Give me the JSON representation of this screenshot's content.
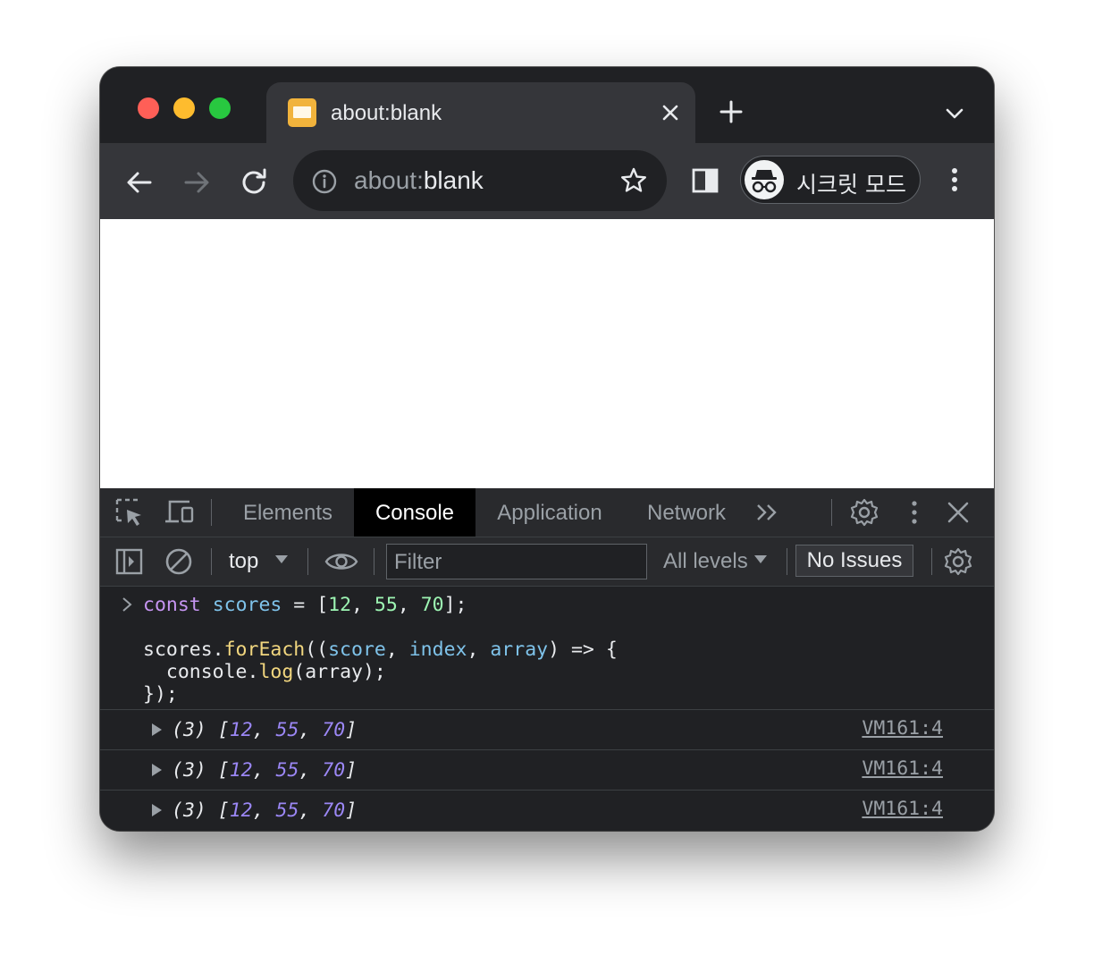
{
  "tab": {
    "title": "about:blank",
    "close_icon": "close-icon"
  },
  "omnibox": {
    "scheme": "about:",
    "host": "blank"
  },
  "incognito": {
    "label": "시크릿 모드"
  },
  "devtools": {
    "tabs": [
      "Elements",
      "Console",
      "Application",
      "Network"
    ],
    "active_tab": "Console",
    "context": "top",
    "filter_placeholder": "Filter",
    "levels": "All levels",
    "issues": "No Issues"
  },
  "console": {
    "input": {
      "line1": {
        "kw": "const",
        "name": "scores",
        "eq": " = [",
        "n1": "12",
        "n2": "55",
        "n3": "70",
        "end": "];"
      },
      "line2": {
        "obj": "scores.",
        "method": "forEach",
        "open": "((",
        "p1": "score",
        "p2": "index",
        "p3": "array",
        "close": ") => {"
      },
      "line3": {
        "indent": "  console.",
        "method": "log",
        "args": "(array);"
      },
      "line4": "});"
    },
    "outputs": [
      {
        "count": "(3) [",
        "values": [
          "12",
          "55",
          "70"
        ],
        "end": "]",
        "source": "VM161:4"
      },
      {
        "count": "(3) [",
        "values": [
          "12",
          "55",
          "70"
        ],
        "end": "]",
        "source": "VM161:4"
      },
      {
        "count": "(3) [",
        "values": [
          "12",
          "55",
          "70"
        ],
        "end": "]",
        "source": "VM161:4"
      }
    ]
  }
}
